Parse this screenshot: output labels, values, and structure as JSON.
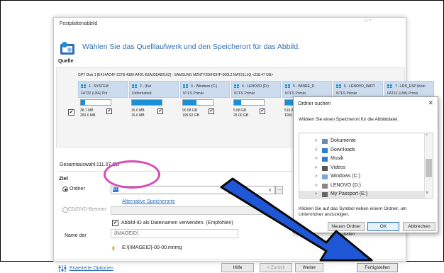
{
  "dialog": {
    "title": "Festplattenabbild",
    "titlebar_buttons": "∷ ^",
    "headline": "Wählen Sie das Quelllaufwerk und den Speicherort für das Abbild.",
    "quelle_label": "Quelle",
    "disk_header": "GPT Disk 1 [E414AC4F-237B-4389-A4D1-B2A335A82162] - SAMSUNG MZNTY256HDHP-000L2 MAT21L1Q  <238.47 GB>",
    "disk_checked": "✔",
    "partitions": [
      {
        "name": "1 - SYSTEM",
        "type": "FAT32 (LBA) Prir",
        "used": "38.7 MB",
        "total": "260.0 MB",
        "fill": 0.15,
        "checked": "✔"
      },
      {
        "name": "2 - (Kei",
        "type": "Unformatted",
        "used": "16.0 MB",
        "total": "16.0 MB",
        "fill": 1.0,
        "checked": "✔"
      },
      {
        "name": "3 - Windows (C:)",
        "type": "NTFS Primär",
        "used": "90.58 GB",
        "total": "195.92 GB",
        "fill": 0.46,
        "checked": "✔"
      },
      {
        "name": "4 - LENOVO (D:)",
        "type": "NTFS Primär",
        "used": "5.88 GB",
        "total": "25.00 GB",
        "fill": 0.24,
        "checked": "✔"
      },
      {
        "name": "5 - WINRE_D",
        "type": "NTFS Primär",
        "used": "516.8 MB",
        "total": "1000.0 MB",
        "fill": 0.52,
        "checked": "✔"
      },
      {
        "name": "6 - LENOVO_PART",
        "type": "NTFS Primär",
        "used": "",
        "total": "",
        "fill": 0.8,
        "checked": ""
      },
      {
        "name": "7 - LRS_ESP (Kein",
        "type": "FAT32 (LBA) Primä",
        "used": "",
        "total": "",
        "fill": 0.3,
        "checked": ""
      }
    ],
    "selection_label": "Gesamtauswahl:",
    "selection_value": "111.07 GB",
    "ziel_label": "Ziel",
    "ordner_label": "Ordner",
    "path_value": "E:\\",
    "path_chevron": "∨",
    "browse_label": "...",
    "alt_link": "Alternative Speicherorte",
    "cd_label": "CD/DVD-Brenner",
    "id_checkbox": "✔",
    "id_label": "Abbild-ID als Dateinamen verwenden. (Empfohlen)",
    "id_label2": "",
    "name_label": "Name der",
    "name_value": "{IMAGEID}",
    "file_path": "E:\\{IMAGEID}-00-00.mrimg",
    "options_link": "Erweiterte Optionen",
    "buttons": {
      "help": "Hilfe",
      "back": "< Zurück",
      "next": "Weiter",
      "finish": "Fertigstellen"
    }
  },
  "folder_dialog": {
    "title": "Ordner suchen",
    "close": "✕",
    "description": "Wählen Sie einen Speicherort für die Abbilddatei.",
    "items": [
      {
        "label": "Dokumente",
        "icon": "documents-icon",
        "color": "#6d8bb9"
      },
      {
        "label": "Downloads",
        "icon": "downloads-icon",
        "color": "#2f7fd0"
      },
      {
        "label": "Musik",
        "icon": "music-icon",
        "color": "#2f7fd0"
      },
      {
        "label": "Videos",
        "icon": "videos-icon",
        "color": "#555555"
      },
      {
        "label": "Windows (C:)",
        "icon": "drive-icon",
        "color": "#7aa7d6"
      },
      {
        "label": "LENOVO (D:)",
        "icon": "drive-icon",
        "color": "#888888"
      },
      {
        "label": "My Passport (E:)",
        "icon": "drive-icon",
        "color": "#666666",
        "selected": true
      }
    ],
    "hint1": "Klicken Sie auf das Symbol neben einem Ordner, um",
    "hint2": "Unterordner anzuzeigen.",
    "buttons": {
      "new_folder": "Neuen Ordner erstellen",
      "ok": "OK",
      "cancel": "Abbrechen"
    }
  },
  "colors": {
    "accent": "#2d6fb5",
    "partition_bar": "#1b8fd6",
    "highlight_circle": "#d64bb8",
    "arrow": "#1f57d6"
  }
}
